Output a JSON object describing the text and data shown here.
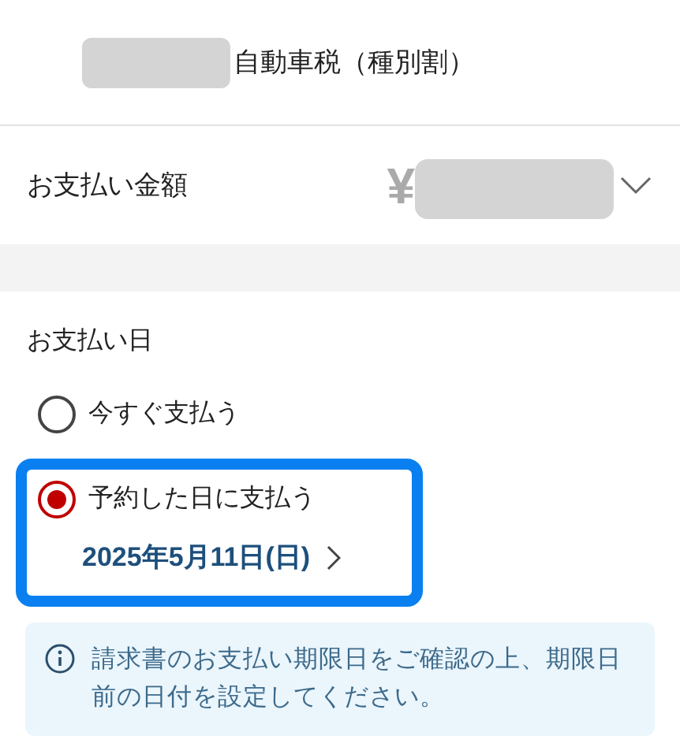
{
  "header": {
    "title": "自動車税（種別割）"
  },
  "amount": {
    "label": "お支払い金額",
    "currency": "¥",
    "expanded": false
  },
  "payment_date": {
    "heading": "お支払い日",
    "options": [
      {
        "label": "今すぐ支払う",
        "selected": false
      },
      {
        "label": "予約した日に支払う",
        "selected": true,
        "date": "2025年5月11日(日)"
      }
    ]
  },
  "notice": {
    "text": "請求書のお支払い期限日をご確認の上、期限日前の日付を設定してください。"
  }
}
